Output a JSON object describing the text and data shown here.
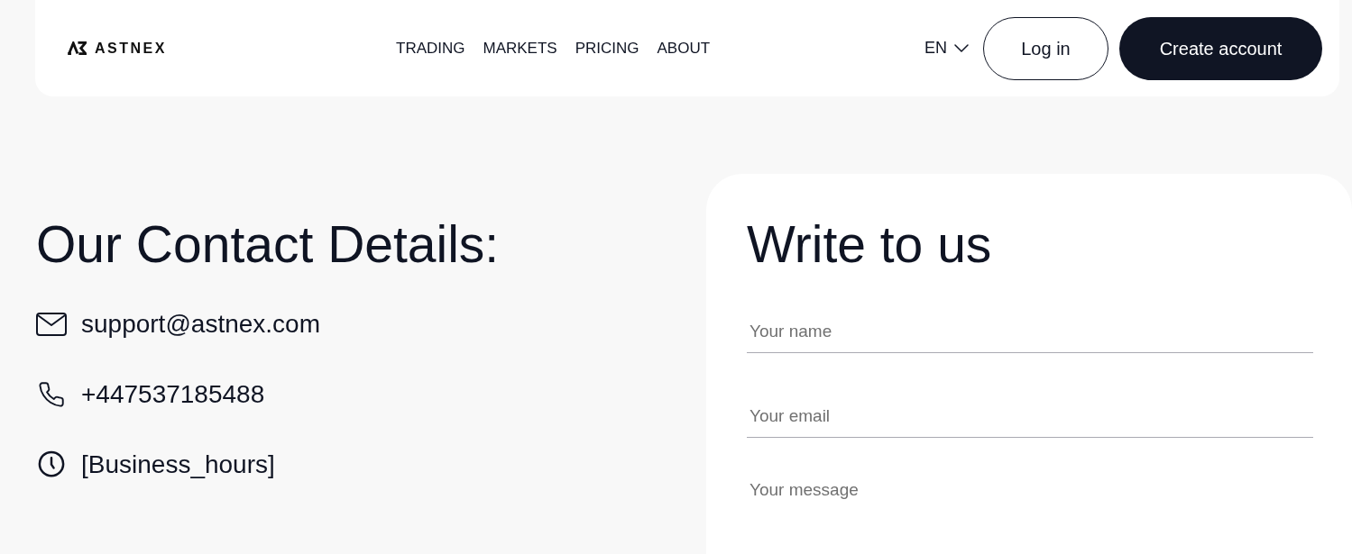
{
  "header": {
    "logo": {
      "text": "ASTNEX"
    },
    "nav": [
      {
        "label": "TRADING"
      },
      {
        "label": "MARKETS"
      },
      {
        "label": "PRICING"
      },
      {
        "label": "ABOUT"
      }
    ],
    "language": {
      "label": "EN"
    },
    "buttons": [
      {
        "label": "Log in",
        "kind": "outline"
      },
      {
        "label": "Create account",
        "kind": "filled"
      }
    ]
  },
  "contact": {
    "title": "Our Contact Details:",
    "items": [
      {
        "kind": "email",
        "text": "support@astnex.com"
      },
      {
        "kind": "phone",
        "text": "+447537185488"
      },
      {
        "kind": "hours",
        "text": "[Business_hours]"
      }
    ]
  },
  "form": {
    "title": "Write to us",
    "fields": [
      {
        "kind": "input",
        "placeholder": "Your name"
      },
      {
        "kind": "input",
        "placeholder": "Your email"
      },
      {
        "kind": "textarea",
        "placeholder": "Your message"
      }
    ]
  }
}
